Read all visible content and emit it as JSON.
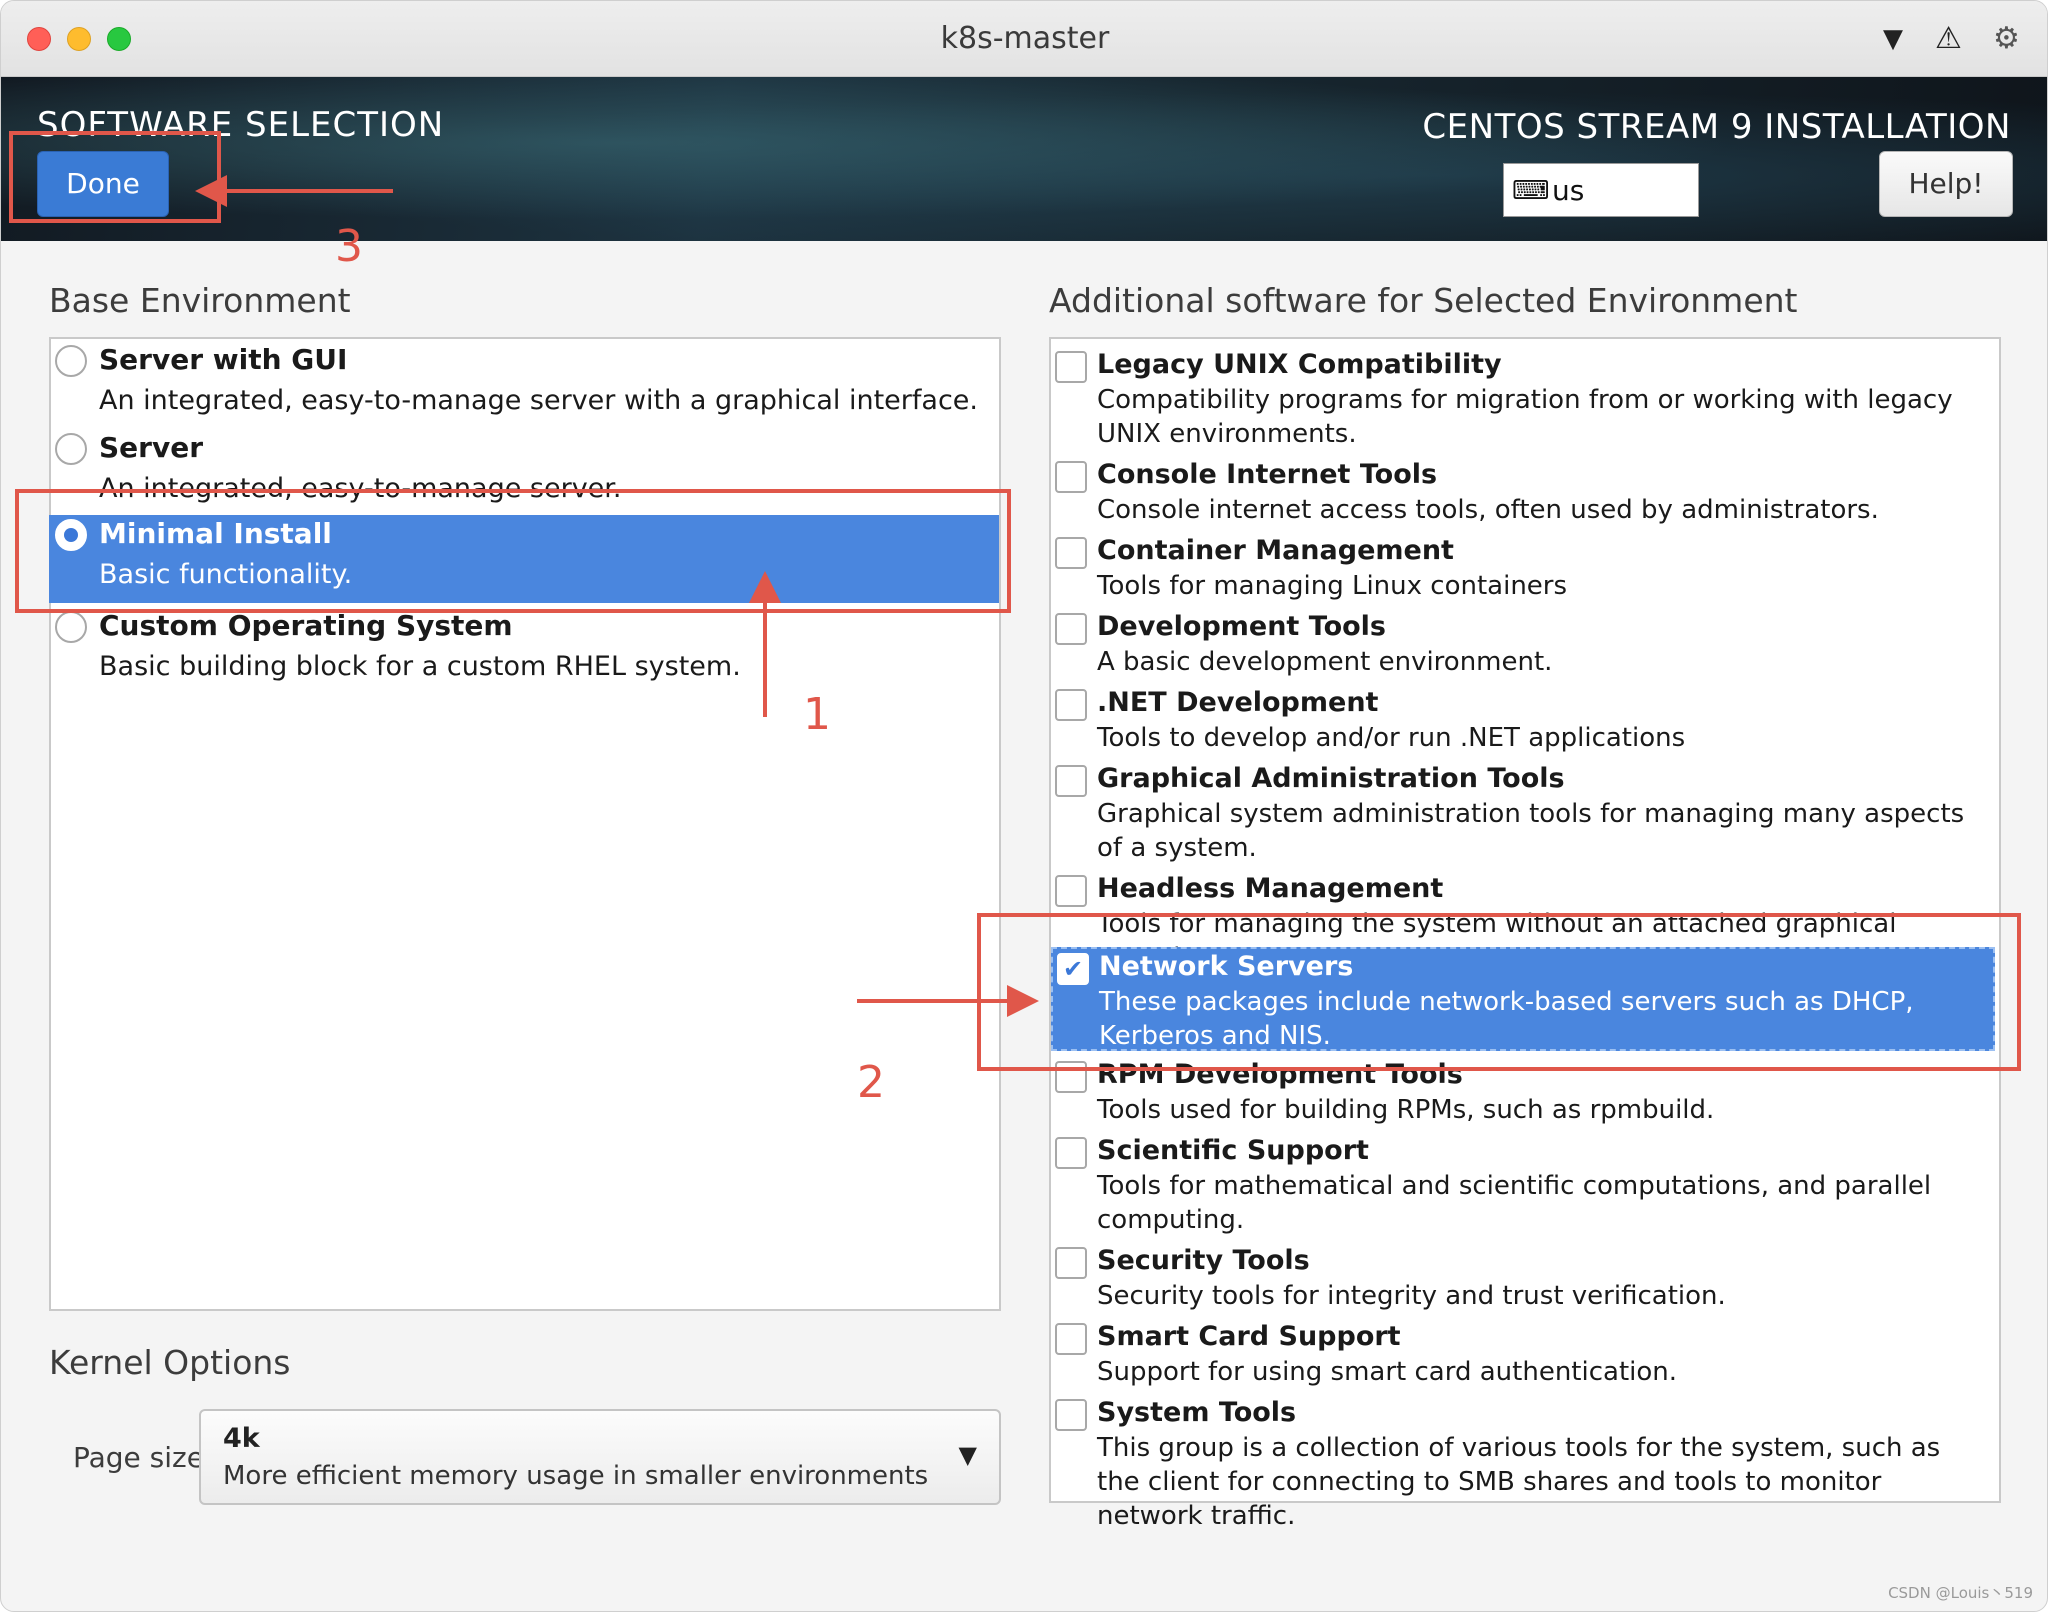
{
  "window": {
    "title": "k8s-master"
  },
  "header": {
    "title": "SOFTWARE SELECTION",
    "done_label": "Done",
    "product": "CENTOS STREAM 9 INSTALLATION",
    "keyboard_layout": "us",
    "help_label": "Help!"
  },
  "base_environment": {
    "title": "Base Environment",
    "items": [
      {
        "name": "Server with GUI",
        "desc": "An integrated, easy-to-manage server with a graphical interface.",
        "selected": false
      },
      {
        "name": "Server",
        "desc": "An integrated, easy-to-manage server.",
        "selected": false
      },
      {
        "name": "Minimal Install",
        "desc": "Basic functionality.",
        "selected": true
      },
      {
        "name": "Custom Operating System",
        "desc": "Basic building block for a custom RHEL system.",
        "selected": false
      }
    ]
  },
  "additional_software": {
    "title": "Additional software for Selected Environment",
    "items": [
      {
        "name": "Legacy UNIX Compatibility",
        "desc": "Compatibility programs for migration from or working with legacy UNIX environments.",
        "checked": false
      },
      {
        "name": "Console Internet Tools",
        "desc": "Console internet access tools, often used by administrators.",
        "checked": false
      },
      {
        "name": "Container Management",
        "desc": "Tools for managing Linux containers",
        "checked": false
      },
      {
        "name": "Development Tools",
        "desc": "A basic development environment.",
        "checked": false
      },
      {
        "name": ".NET Development",
        "desc": "Tools to develop and/or run .NET applications",
        "checked": false
      },
      {
        "name": "Graphical Administration Tools",
        "desc": "Graphical system administration tools for managing many aspects of a system.",
        "checked": false
      },
      {
        "name": "Headless Management",
        "desc": "Tools for managing the system without an attached graphical console.",
        "checked": false
      },
      {
        "name": "Network Servers",
        "desc": "These packages include network-based servers such as DHCP, Kerberos and NIS.",
        "checked": true
      },
      {
        "name": "RPM Development Tools",
        "desc": "Tools used for building RPMs, such as rpmbuild.",
        "checked": false
      },
      {
        "name": "Scientific Support",
        "desc": "Tools for mathematical and scientific computations, and parallel computing.",
        "checked": false
      },
      {
        "name": "Security Tools",
        "desc": "Security tools for integrity and trust verification.",
        "checked": false
      },
      {
        "name": "Smart Card Support",
        "desc": "Support for using smart card authentication.",
        "checked": false
      },
      {
        "name": "System Tools",
        "desc": "This group is a collection of various tools for the system, such as the client for connecting to SMB shares and tools to monitor network traffic.",
        "checked": false
      }
    ]
  },
  "kernel_options": {
    "title": "Kernel Options",
    "page_size_label": "Page size:",
    "page_size_value": "4k",
    "page_size_desc": "More efficient memory usage in smaller environments"
  },
  "annotations": {
    "step1": "1",
    "step2": "2",
    "step3": "3",
    "color": "#e0574a"
  },
  "icons": {
    "dropdown": "triangle-down-icon",
    "warning": "warning-icon",
    "settings": "gear-icon",
    "keyboard": "keyboard-icon",
    "checkmark": "checkmark-icon"
  },
  "watermark": "CSDN @Louis丶519"
}
